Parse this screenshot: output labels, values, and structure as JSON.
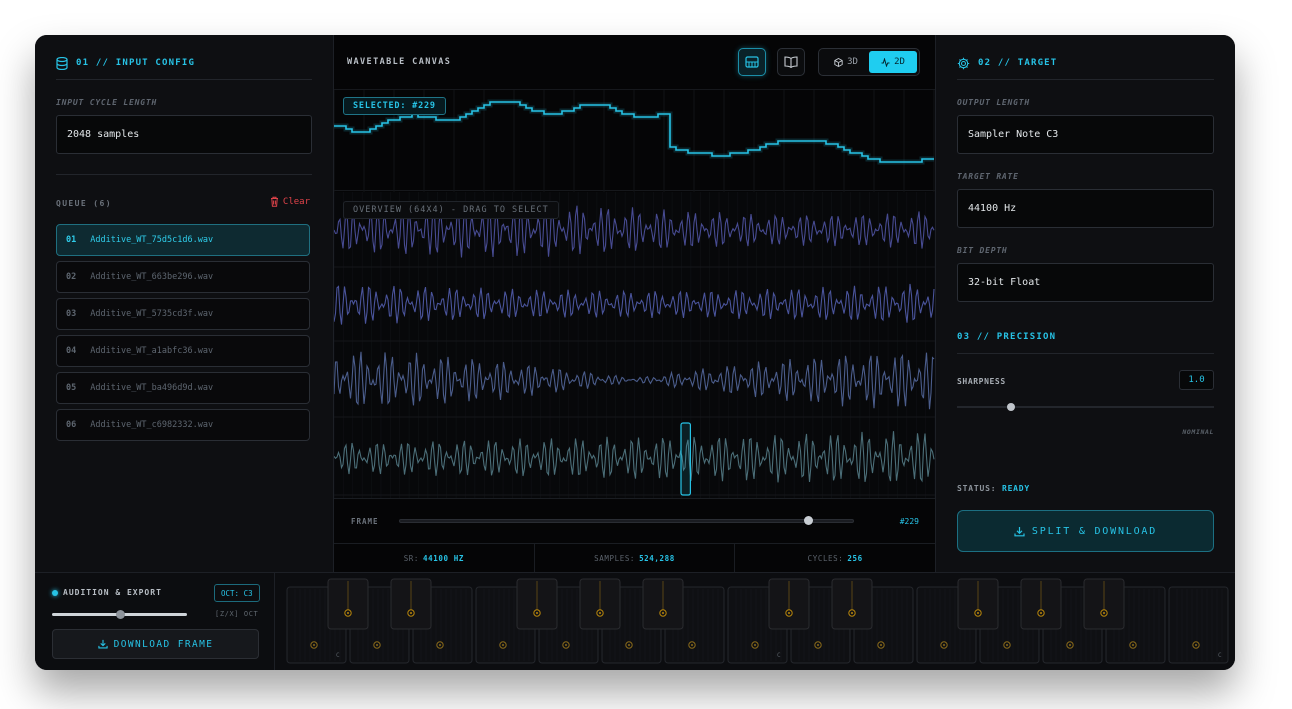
{
  "input_config": {
    "title": "01 // INPUT CONFIG",
    "cycle_label": "INPUT CYCLE LENGTH",
    "cycle_value": "2048 samples"
  },
  "queue": {
    "title": "QUEUE (6)",
    "clear_label": "Clear",
    "items": [
      {
        "num": "01",
        "name": "Additive_WT_75d5c1d6.wav"
      },
      {
        "num": "02",
        "name": "Additive_WT_663be296.wav"
      },
      {
        "num": "03",
        "name": "Additive_WT_5735cd3f.wav"
      },
      {
        "num": "04",
        "name": "Additive_WT_a1abfc36.wav"
      },
      {
        "num": "05",
        "name": "Additive_WT_ba496d9d.wav"
      },
      {
        "num": "06",
        "name": "Additive_WT_c6982332.wav"
      }
    ]
  },
  "canvas": {
    "title": "WAVETABLE CANVAS",
    "mode_3d": "3D",
    "mode_2d": "2D",
    "selected_badge": "SELECTED: #229",
    "overview_label": "OVERVIEW (64X4) - DRAG TO SELECT",
    "frame_label": "FRAME",
    "frame_value": "#229",
    "frame_position": 0.9,
    "stats": [
      {
        "label": "SR:",
        "value": "44100 HZ"
      },
      {
        "label": "SAMPLES:",
        "value": "524,288"
      },
      {
        "label": "CYCLES:",
        "value": "256"
      }
    ]
  },
  "target": {
    "title": "02 // TARGET",
    "output_label": "OUTPUT LENGTH",
    "output_value": "Sampler Note C3",
    "rate_label": "TARGET RATE",
    "rate_value": "44100 Hz",
    "depth_label": "BIT DEPTH",
    "depth_value": "32-bit Float"
  },
  "precision": {
    "title": "03 // PRECISION",
    "sharpness_label": "SHARPNESS",
    "sharpness_value": "1.0",
    "sharpness_position": 0.21,
    "nominal_label": "NOMINAL",
    "status_label": "STATUS:",
    "status_value": "READY",
    "split_label": "SPLIT & DOWNLOAD"
  },
  "audition": {
    "title": "AUDITION & EXPORT",
    "oct_badge": "OCT: C3",
    "oct_hint": "[Z/X] OCT",
    "volume_position": 0.5,
    "download_label": "DOWNLOAD FRAME",
    "key_labels": [
      "C",
      "C",
      "C",
      "C"
    ]
  },
  "colors": {
    "accent": "#27c3e6",
    "danger": "#e0434a",
    "panel": "#0e0f12",
    "key_accent": "#b8860b"
  }
}
